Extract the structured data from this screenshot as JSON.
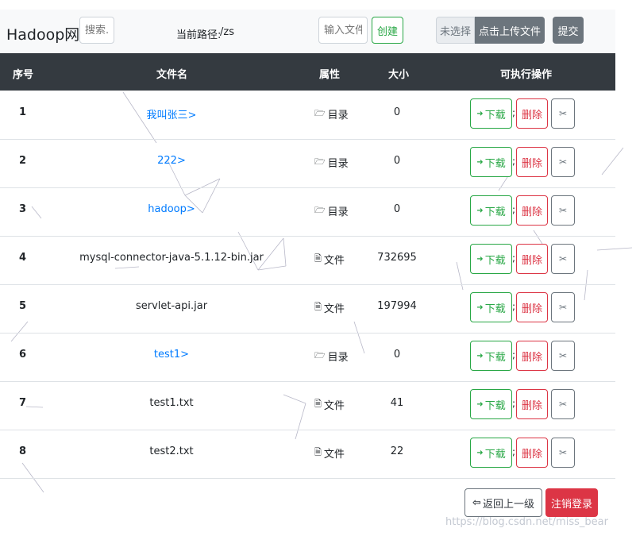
{
  "navbar": {
    "brand": "Hadoop网盘",
    "search_placeholder": "搜索..",
    "path_label": "当前路径:",
    "path_value": "/zs",
    "new_name_placeholder": "输入文件",
    "create_label": "创建",
    "file_choose_label": "未选择",
    "upload_label": "点击上传文件",
    "submit_label": "提交"
  },
  "table": {
    "headers": [
      "序号",
      "文件名",
      "属性",
      "大小",
      "可执行操作"
    ],
    "rows": [
      {
        "index": "1",
        "name": "我叫张三>",
        "is_dir": true,
        "type": "目录",
        "size": "0"
      },
      {
        "index": "2",
        "name": "222>",
        "is_dir": true,
        "type": "目录",
        "size": "0"
      },
      {
        "index": "3",
        "name": "hadoop>",
        "is_dir": true,
        "type": "目录",
        "size": "0"
      },
      {
        "index": "4",
        "name": "mysql-connector-java-5.1.12-bin.jar",
        "is_dir": false,
        "type": "文件",
        "size": "732695"
      },
      {
        "index": "5",
        "name": "servlet-api.jar",
        "is_dir": false,
        "type": "文件",
        "size": "197994"
      },
      {
        "index": "6",
        "name": "test1>",
        "is_dir": true,
        "type": "目录",
        "size": "0"
      },
      {
        "index": "7",
        "name": "test1.txt",
        "is_dir": false,
        "type": "文件",
        "size": "41"
      },
      {
        "index": "8",
        "name": "test2.txt",
        "is_dir": false,
        "type": "文件",
        "size": "22"
      }
    ],
    "actions": {
      "download": "下载",
      "delete": "删除",
      "separator": ";"
    }
  },
  "footer": {
    "back_label": "返回上一级",
    "logout_label": "注销登录"
  },
  "watermark": "https://blog.csdn.net/miss_bear",
  "colors": {
    "header_bg": "#343a40",
    "navbar_bg": "#f8f9fa",
    "success": "#28a745",
    "danger": "#dc3545",
    "secondary": "#6c757d",
    "link": "#007bff"
  },
  "icons": {
    "directory": "folder-open-icon",
    "file": "file-text-icon",
    "download": "sign-in-icon",
    "cut": "scissors-icon",
    "back": "arrow-left-icon"
  }
}
